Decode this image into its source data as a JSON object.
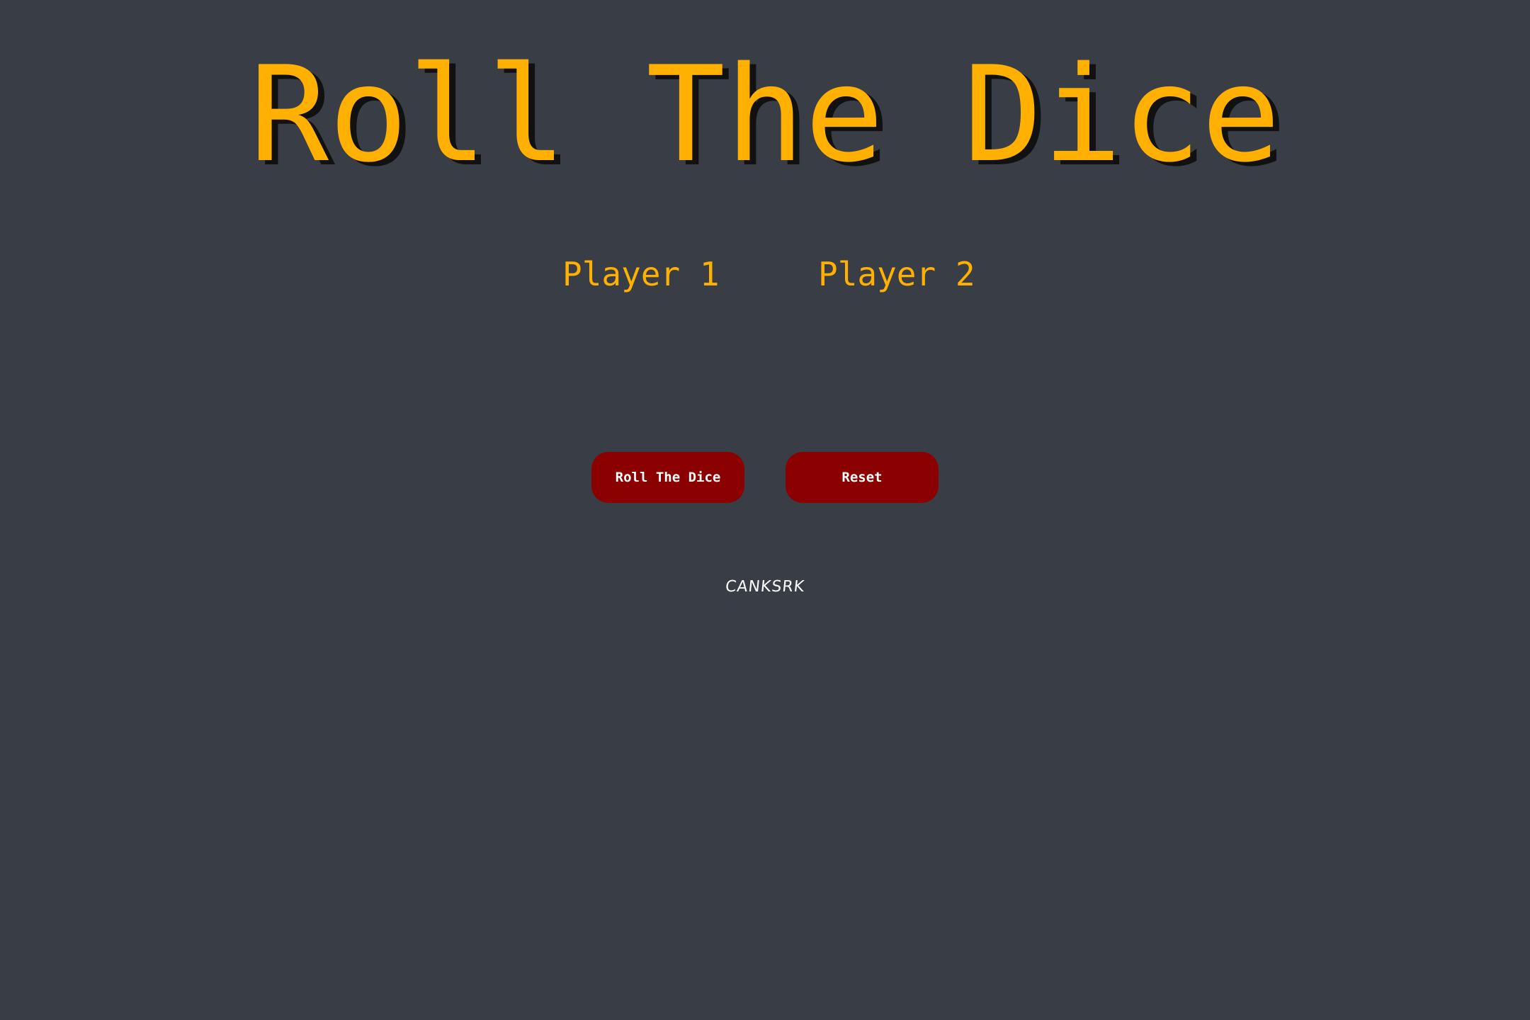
{
  "header": {
    "title": "Roll The Dice"
  },
  "players": [
    {
      "label": "Player 1"
    },
    {
      "label": "Player 2"
    }
  ],
  "controls": {
    "roll_label": "Roll The Dice",
    "reset_label": "Reset"
  },
  "footer": {
    "credit": "CANKSRK"
  },
  "colors": {
    "background": "#393e46",
    "accent": "#ffb000",
    "button": "#8b0000",
    "button_text": "#ffffff"
  }
}
